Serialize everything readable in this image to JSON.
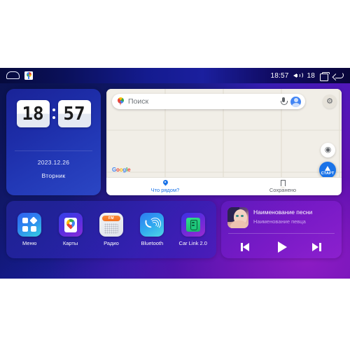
{
  "statusbar": {
    "home_icon": "home-icon",
    "maps_icon": "google-maps-icon",
    "time": "18:57",
    "volume_icon": "speaker-icon",
    "volume_level": "18",
    "recents_icon": "recent-apps-icon",
    "back_icon": "back-arrow-icon"
  },
  "clock_widget": {
    "hours": "18",
    "minutes": "57",
    "date": "2023.12.26",
    "weekday": "Вторник"
  },
  "maps_widget": {
    "search_placeholder": "Поиск",
    "pin_icon": "google-maps-pin-icon",
    "mic_icon": "microphone-icon",
    "avatar_icon": "account-avatar-icon",
    "gear_icon": "settings-gear-icon",
    "gear_glyph": "⚙",
    "locate_icon": "my-location-icon",
    "locate_glyph": "◉",
    "start_label": "СТАРТ",
    "watermark": {
      "g": "G",
      "o1": "o",
      "o2": "o",
      "g2": "g",
      "l": "l",
      "e": "e"
    },
    "tabs": [
      {
        "label": "Что рядом?",
        "icon": "location-pin-icon",
        "active": true
      },
      {
        "label": "Сохранено",
        "icon": "bookmark-icon",
        "active": false
      }
    ]
  },
  "dock": {
    "apps": [
      {
        "label": "Меню",
        "icon": "apps-grid-icon"
      },
      {
        "label": "Карты",
        "icon": "maps-app-icon"
      },
      {
        "label": "Радио",
        "icon": "radio-icon",
        "band": "FM"
      },
      {
        "label": "Bluetooth",
        "icon": "bluetooth-phone-icon"
      },
      {
        "label": "Car Link 2.0",
        "icon": "car-link-icon"
      }
    ]
  },
  "music_widget": {
    "cover_icon": "album-cover-art",
    "title": "Наименование песни",
    "artist": "Наименование певца",
    "controls": [
      {
        "name": "previous-track-button",
        "icon": "skip-previous-icon"
      },
      {
        "name": "play-button",
        "icon": "play-icon"
      },
      {
        "name": "next-track-button",
        "icon": "skip-next-icon"
      }
    ]
  },
  "colors": {
    "accent_blue": "#1a73e8",
    "bg_navy": "#141a86",
    "bg_purple": "#6a10bd",
    "music_purple": "#781ac8",
    "radio_orange": "#f2701f"
  }
}
